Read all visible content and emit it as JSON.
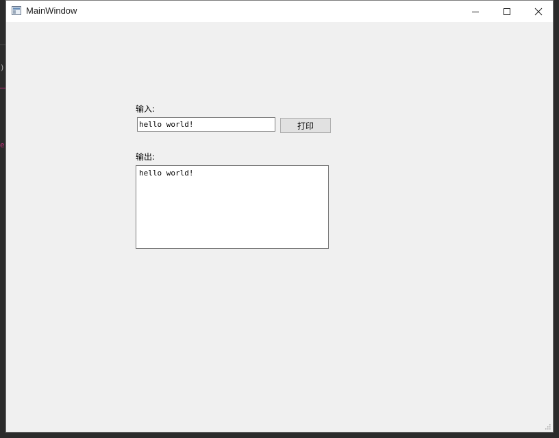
{
  "window": {
    "title": "MainWindow"
  },
  "form": {
    "input_label": "输入:",
    "input_value": "hello world!",
    "print_button_label": "打印",
    "output_label": "输出:",
    "output_text": "hello world!"
  },
  "background": {
    "glyph1": ")",
    "glyph2": "e"
  },
  "colors": {
    "window_bg": "#f0f0f0",
    "titlebar_bg": "#ffffff",
    "backdrop": "#2b2b2b",
    "accent": "#c0307a"
  },
  "icons": {
    "app": "app-window-icon",
    "minimize": "minimize-icon",
    "maximize": "maximize-icon",
    "close": "close-icon",
    "grip": "resize-grip-icon"
  }
}
